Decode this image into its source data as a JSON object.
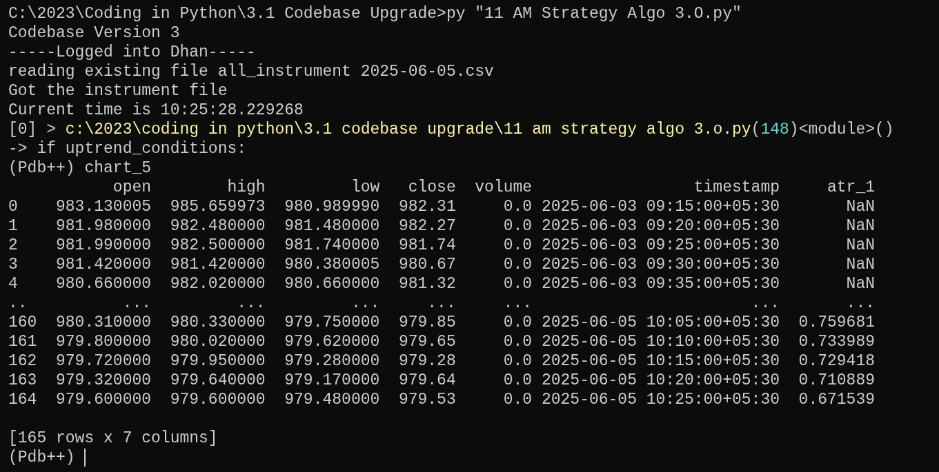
{
  "terminal": {
    "lines": [
      {
        "text": "C:\\2023\\Coding in Python\\3.1 Codebase Upgrade>py \"11 AM Strategy Algo 3.O.py\""
      },
      {
        "text": "Codebase Version 3"
      },
      {
        "text": "-----Logged into Dhan-----"
      },
      {
        "text": "reading existing file all_instrument 2025-06-05.csv"
      },
      {
        "text": "Got the instrument file"
      },
      {
        "text": "Current time is 10:25:28.229268"
      },
      {
        "segments": [
          {
            "kind": "plain",
            "text": "[0] > "
          },
          {
            "kind": "path",
            "text": "c:\\2023\\coding in python\\3.1 codebase upgrade\\11 am strategy algo 3.o.py"
          },
          {
            "kind": "plain",
            "text": "("
          },
          {
            "kind": "number",
            "text": "148"
          },
          {
            "kind": "plain",
            "text": ")<module>()"
          }
        ]
      },
      {
        "text": "-> if uptrend_conditions:"
      },
      {
        "text": "(Pdb++) chart_5"
      },
      {
        "text": "           open        high         low   close  volume                 timestamp     atr_1"
      },
      {
        "text": "0    983.130005  985.659973  980.989990  982.31     0.0 2025-06-03 09:15:00+05:30       NaN"
      },
      {
        "text": "1    981.980000  982.480000  981.480000  982.27     0.0 2025-06-03 09:20:00+05:30       NaN"
      },
      {
        "text": "2    981.990000  982.500000  981.740000  981.74     0.0 2025-06-03 09:25:00+05:30       NaN"
      },
      {
        "text": "3    981.420000  981.420000  980.380005  980.67     0.0 2025-06-03 09:30:00+05:30       NaN"
      },
      {
        "text": "4    980.660000  982.020000  980.660000  981.32     0.0 2025-06-03 09:35:00+05:30       NaN"
      },
      {
        "text": "..          ...         ...         ...     ...     ...                       ...       ..."
      },
      {
        "text": "160  980.310000  980.330000  979.750000  979.85     0.0 2025-06-05 10:05:00+05:30  0.759681"
      },
      {
        "text": "161  979.800000  980.020000  979.620000  979.65     0.0 2025-06-05 10:10:00+05:30  0.733989"
      },
      {
        "text": "162  979.720000  979.950000  979.280000  979.28     0.0 2025-06-05 10:15:00+05:30  0.729418"
      },
      {
        "text": "163  979.320000  979.640000  979.170000  979.64     0.0 2025-06-05 10:20:00+05:30  0.710889"
      },
      {
        "text": "164  979.600000  979.600000  979.480000  979.53     0.0 2025-06-05 10:25:00+05:30  0.671539"
      }
    ],
    "summary": {
      "text": "[165 rows x 7 columns]"
    },
    "prompt": {
      "text": "(Pdb++) "
    }
  }
}
